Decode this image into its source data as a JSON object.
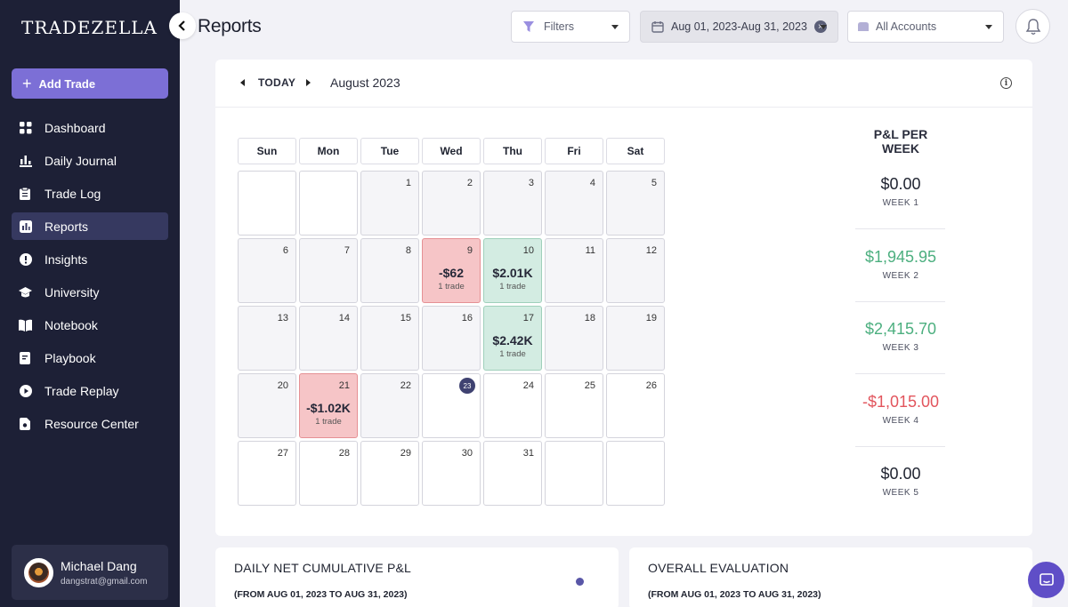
{
  "app": {
    "logo_text": "TRADEZELLA",
    "add_trade_label": "Add Trade"
  },
  "sidebar": {
    "items": [
      {
        "label": "Dashboard",
        "icon": "dashboard-icon",
        "active": false
      },
      {
        "label": "Daily Journal",
        "icon": "bar-chart-icon",
        "active": false
      },
      {
        "label": "Trade Log",
        "icon": "clipboard-icon",
        "active": false
      },
      {
        "label": "Reports",
        "icon": "reports-icon",
        "active": true
      },
      {
        "label": "Insights",
        "icon": "insights-icon",
        "active": false
      },
      {
        "label": "University",
        "icon": "graduation-cap-icon",
        "active": false
      },
      {
        "label": "Notebook",
        "icon": "book-icon",
        "active": false
      },
      {
        "label": "Playbook",
        "icon": "playbook-icon",
        "active": false
      },
      {
        "label": "Trade Replay",
        "icon": "play-icon",
        "active": false
      },
      {
        "label": "Resource Center",
        "icon": "resource-icon",
        "active": false
      }
    ],
    "user": {
      "name": "Michael Dang",
      "email": "dangstrat@gmail.com"
    }
  },
  "header": {
    "title": "Reports",
    "filters_label": "Filters",
    "date_range": "Aug 01, 2023-Aug 31, 2023",
    "accounts_label": "All Accounts"
  },
  "calendar": {
    "today_label": "TODAY",
    "month_label": "August 2023",
    "weekdays": [
      "Sun",
      "Mon",
      "Tue",
      "Wed",
      "Thu",
      "Fri",
      "Sat"
    ],
    "today_date": "23",
    "weeks": [
      [
        {
          "day": ""
        },
        {
          "day": ""
        },
        {
          "day": "1"
        },
        {
          "day": "2"
        },
        {
          "day": "3"
        },
        {
          "day": "4"
        },
        {
          "day": "5"
        }
      ],
      [
        {
          "day": "6"
        },
        {
          "day": "7"
        },
        {
          "day": "8"
        },
        {
          "day": "9",
          "pnl": "-$62",
          "trades": "1 trade",
          "status": "loss"
        },
        {
          "day": "10",
          "pnl": "$2.01K",
          "trades": "1 trade",
          "status": "win"
        },
        {
          "day": "11"
        },
        {
          "day": "12"
        }
      ],
      [
        {
          "day": "13"
        },
        {
          "day": "14"
        },
        {
          "day": "15"
        },
        {
          "day": "16"
        },
        {
          "day": "17",
          "pnl": "$2.42K",
          "trades": "1 trade",
          "status": "win"
        },
        {
          "day": "18"
        },
        {
          "day": "19"
        }
      ],
      [
        {
          "day": "20"
        },
        {
          "day": "21",
          "pnl": "-$1.02K",
          "trades": "1 trade",
          "status": "loss"
        },
        {
          "day": "22"
        },
        {
          "day": "23"
        },
        {
          "day": "24"
        },
        {
          "day": "25"
        },
        {
          "day": "26"
        }
      ],
      [
        {
          "day": "27"
        },
        {
          "day": "28"
        },
        {
          "day": "29"
        },
        {
          "day": "30"
        },
        {
          "day": "31"
        },
        {
          "day": ""
        },
        {
          "day": ""
        }
      ]
    ]
  },
  "weekly": {
    "title": "P&L PER WEEK",
    "weeks": [
      {
        "amount": "$0.00",
        "label": "WEEK 1",
        "tone": "neutral"
      },
      {
        "amount": "$1,945.95",
        "label": "WEEK 2",
        "tone": "pos"
      },
      {
        "amount": "$2,415.70",
        "label": "WEEK 3",
        "tone": "pos"
      },
      {
        "amount": "-$1,015.00",
        "label": "WEEK 4",
        "tone": "neg"
      },
      {
        "amount": "$0.00",
        "label": "WEEK 5",
        "tone": "neutral"
      }
    ]
  },
  "cumulative_card": {
    "title": "DAILY NET CUMULATIVE P&L",
    "subtitle": "(FROM AUG 01, 2023 TO AUG 31, 2023)"
  },
  "evaluation_card": {
    "title": "OVERALL EVALUATION",
    "subtitle": "(FROM AUG 01, 2023 TO AUG 31, 2023)"
  },
  "colors": {
    "sidebar_bg": "#1d2036",
    "accent": "#7c6fd6",
    "win_bg": "#d3ece2",
    "loss_bg": "#f6c5c7",
    "positive": "#4caf7f",
    "negative": "#e2555d"
  }
}
